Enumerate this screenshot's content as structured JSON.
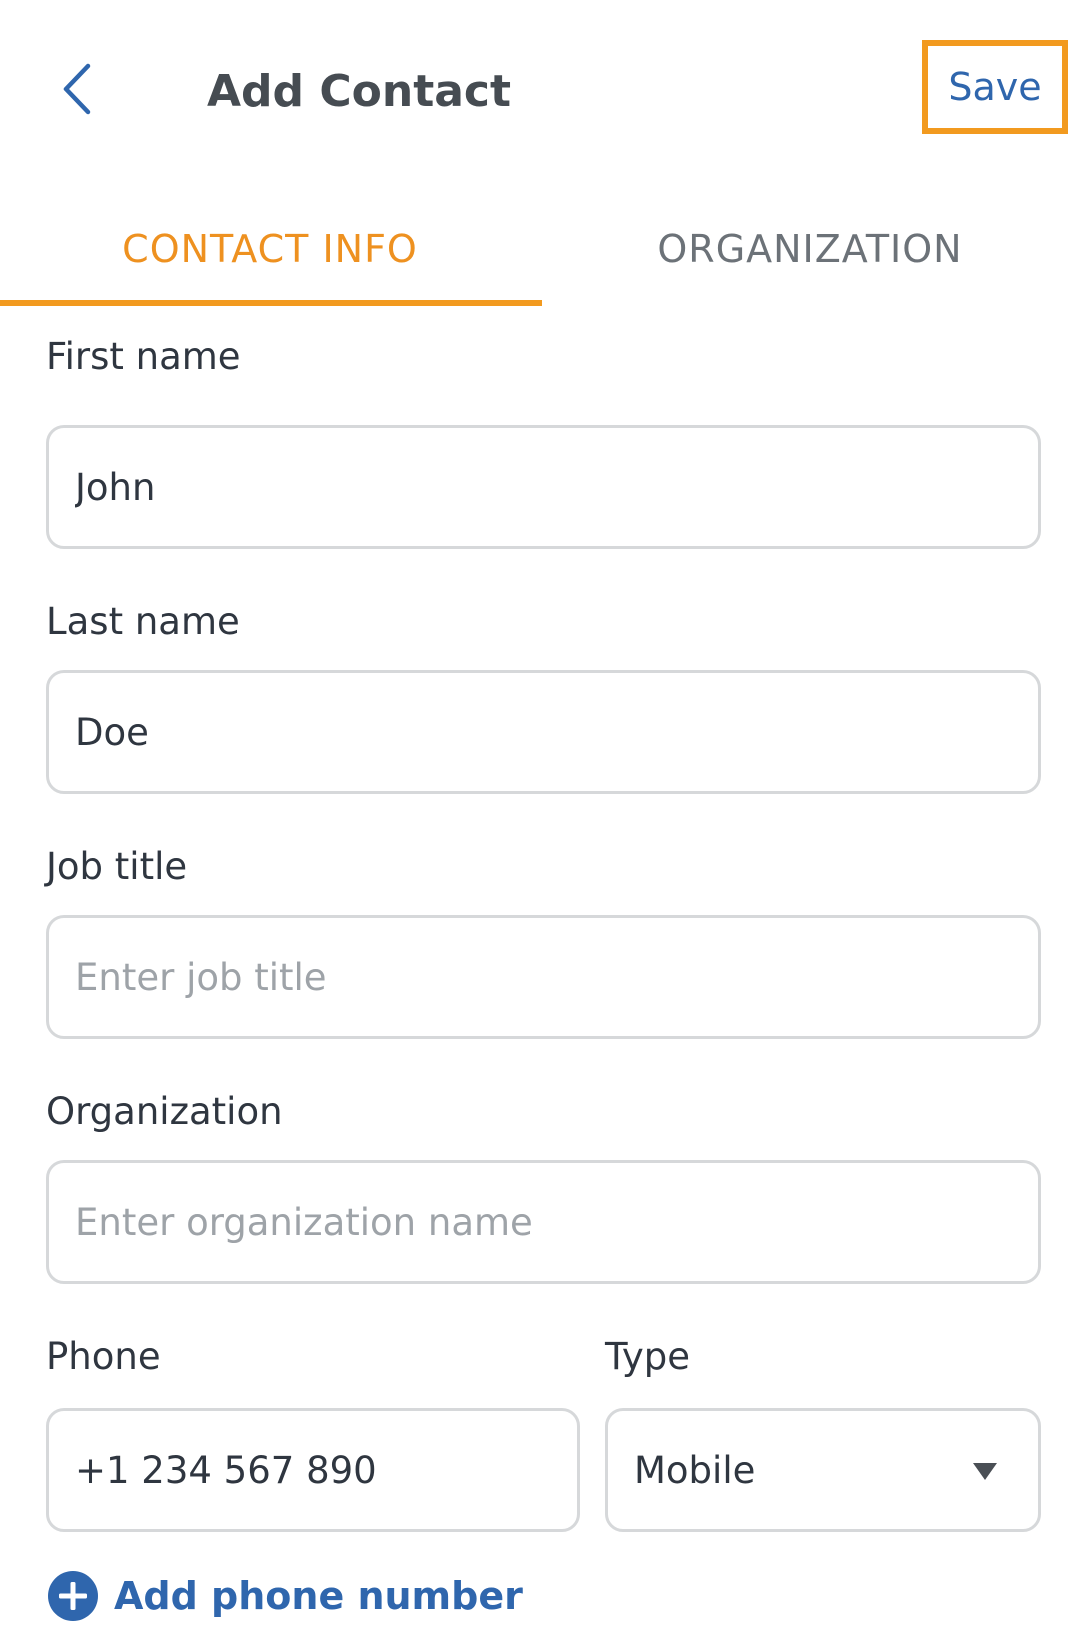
{
  "header": {
    "title": "Add Contact",
    "save_label": "Save"
  },
  "tabs": [
    {
      "label": "CONTACT INFO",
      "active": true
    },
    {
      "label": "ORGANIZATION",
      "active": false
    }
  ],
  "form": {
    "first_name": {
      "label": "First name",
      "value": "John",
      "placeholder": ""
    },
    "last_name": {
      "label": "Last name",
      "value": "Doe",
      "placeholder": ""
    },
    "job_title": {
      "label": "Job title",
      "value": "",
      "placeholder": "Enter job title"
    },
    "organization": {
      "label": "Organization",
      "value": "",
      "placeholder": "Enter organization name"
    },
    "phone": {
      "label": "Phone",
      "value": "+1 234 567 890"
    },
    "type": {
      "label": "Type",
      "selected": "Mobile"
    },
    "add_phone_label": "Add phone number"
  },
  "colors": {
    "accent": "#f29a1f",
    "link": "#2f66ad",
    "border": "#d6d8da"
  },
  "icons": {
    "back": "chevron-left-icon",
    "dropdown": "caret-down-icon",
    "add": "plus-circle-icon"
  }
}
